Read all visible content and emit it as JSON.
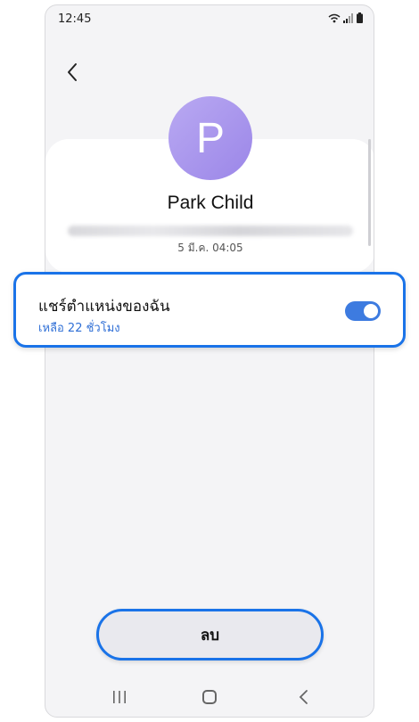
{
  "status_bar": {
    "time": "12:45"
  },
  "contact": {
    "initial": "P",
    "name": "Park Child",
    "time": "5 มี.ค. 04:05"
  },
  "share": {
    "title": "แชร์ตำแหน่งของฉัน",
    "subtitle": "เหลือ 22 ชั่วโมง",
    "enabled": true
  },
  "actions": {
    "delete_label": "ลบ"
  },
  "colors": {
    "accent": "#1a73e8",
    "toggle_on": "#3d7be0",
    "avatar": "#a896ee"
  }
}
